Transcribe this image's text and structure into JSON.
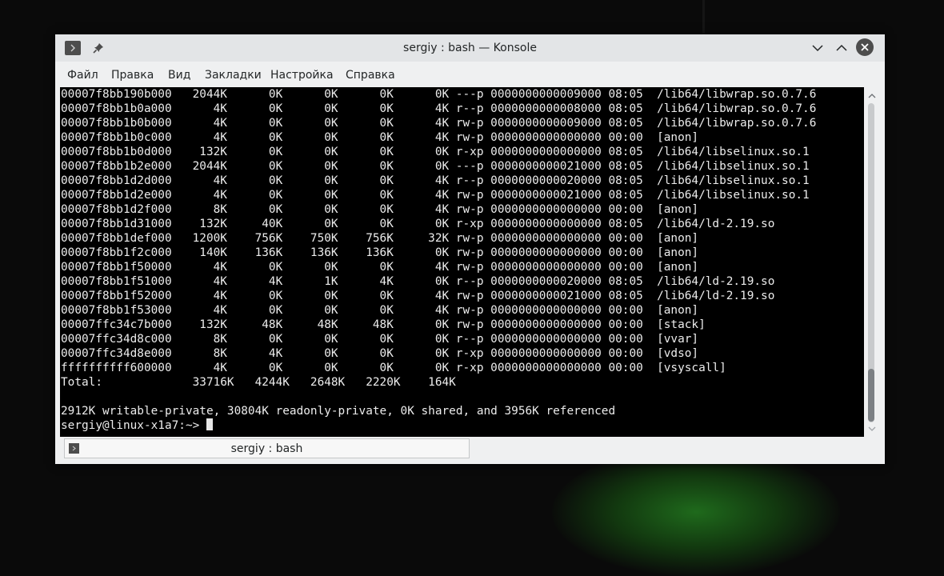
{
  "window": {
    "title": "sergiy : bash — Konsole",
    "icons": {
      "app_menu": "terminal-icon",
      "pin": "pin-icon",
      "minimize": "chevron-down-icon",
      "maximize": "chevron-up-icon",
      "close": "close-icon"
    }
  },
  "menu": {
    "items": [
      "Файл",
      "Правка",
      "Вид",
      "Закладки",
      "Настройка",
      "Справка"
    ]
  },
  "terminal": {
    "lines": [
      "00007f8bb190b000   2044K      0K      0K      0K      0K ---p 0000000000009000 08:05  /lib64/libwrap.so.0.7.6",
      "00007f8bb1b0a000      4K      0K      0K      0K      4K r--p 0000000000008000 08:05  /lib64/libwrap.so.0.7.6",
      "00007f8bb1b0b000      4K      0K      0K      0K      4K rw-p 0000000000009000 08:05  /lib64/libwrap.so.0.7.6",
      "00007f8bb1b0c000      4K      0K      0K      0K      4K rw-p 0000000000000000 00:00  [anon]",
      "00007f8bb1b0d000    132K      0K      0K      0K      0K r-xp 0000000000000000 08:05  /lib64/libselinux.so.1",
      "00007f8bb1b2e000   2044K      0K      0K      0K      0K ---p 0000000000021000 08:05  /lib64/libselinux.so.1",
      "00007f8bb1d2d000      4K      0K      0K      0K      4K r--p 0000000000020000 08:05  /lib64/libselinux.so.1",
      "00007f8bb1d2e000      4K      0K      0K      0K      4K rw-p 0000000000021000 08:05  /lib64/libselinux.so.1",
      "00007f8bb1d2f000      8K      0K      0K      0K      4K rw-p 0000000000000000 00:00  [anon]",
      "00007f8bb1d31000    132K     40K      0K      0K      0K r-xp 0000000000000000 08:05  /lib64/ld-2.19.so",
      "00007f8bb1def000   1200K    756K    750K    756K     32K rw-p 0000000000000000 00:00  [anon]",
      "00007f8bb1f2c000    140K    136K    136K    136K      0K rw-p 0000000000000000 00:00  [anon]",
      "00007f8bb1f50000      4K      0K      0K      0K      4K rw-p 0000000000000000 00:00  [anon]",
      "00007f8bb1f51000      4K      4K      1K      4K      0K r--p 0000000000020000 08:05  /lib64/ld-2.19.so",
      "00007f8bb1f52000      4K      0K      0K      0K      4K rw-p 0000000000021000 08:05  /lib64/ld-2.19.so",
      "00007f8bb1f53000      4K      0K      0K      0K      4K rw-p 0000000000000000 00:00  [anon]",
      "00007ffc34c7b000    132K     48K     48K     48K      0K rw-p 0000000000000000 00:00  [stack]",
      "00007ffc34d8c000      8K      0K      0K      0K      0K r--p 0000000000000000 00:00  [vvar]",
      "00007ffc34d8e000      8K      4K      0K      0K      0K r-xp 0000000000000000 00:00  [vdso]",
      "ffffffffff600000      4K      0K      0K      0K      0K r-xp 0000000000000000 00:00  [vsyscall]",
      "Total:             33716K   4244K   2648K   2220K    164K",
      "",
      "2912K writable-private, 30804K readonly-private, 0K shared, and 3956K referenced"
    ],
    "prompt": "sergiy@linux-x1a7:~> "
  },
  "scrollbar": {
    "position": 1.0
  },
  "tabs": [
    {
      "label": "sergiy : bash",
      "icon": "terminal-icon"
    }
  ]
}
